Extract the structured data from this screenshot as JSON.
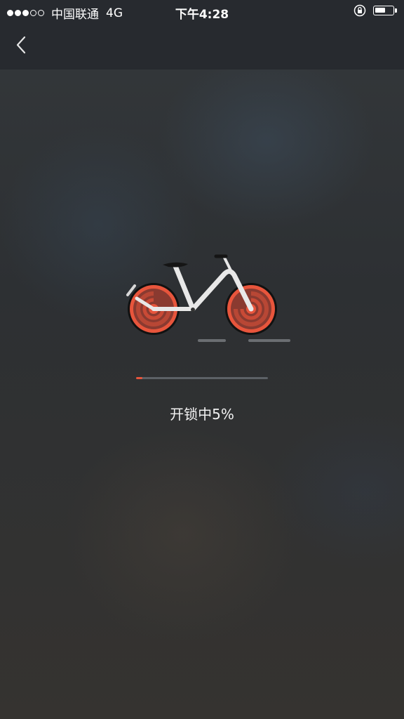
{
  "status_bar": {
    "carrier": "中国联通",
    "network": "4G",
    "time": "下午4:28",
    "signal_bars_filled": 3,
    "signal_bars_total": 5,
    "battery_level": 0.6
  },
  "nav": {
    "back_icon": "chevron-left-icon"
  },
  "unlock": {
    "status_text": "开锁中5%",
    "progress": 0.05,
    "accent_color": "#e8553c"
  },
  "colors": {
    "header_bg": "#272a2f",
    "wheel": "#e8553c",
    "frame": "#e8e8e8"
  }
}
